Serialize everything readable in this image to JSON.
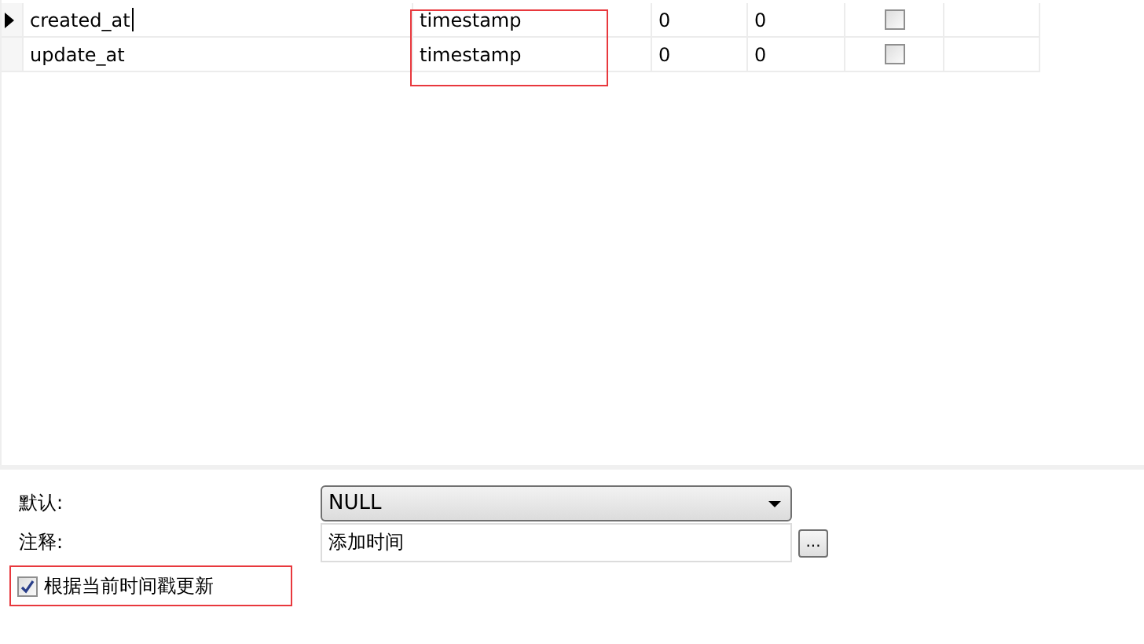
{
  "table": {
    "rows": [
      {
        "current": true,
        "name": "created_at",
        "type": "timestamp",
        "length": "0",
        "decimals": "0",
        "not_null": false
      },
      {
        "current": false,
        "name": "update_at",
        "type": "timestamp",
        "length": "0",
        "decimals": "0",
        "not_null": false
      }
    ]
  },
  "properties": {
    "default_label": "默认:",
    "default_value": "NULL",
    "comment_label": "注释:",
    "comment_value": "添加时间",
    "more_button": "...",
    "update_on_timestamp": {
      "label": "根据当前时间戳更新",
      "checked": true
    }
  }
}
